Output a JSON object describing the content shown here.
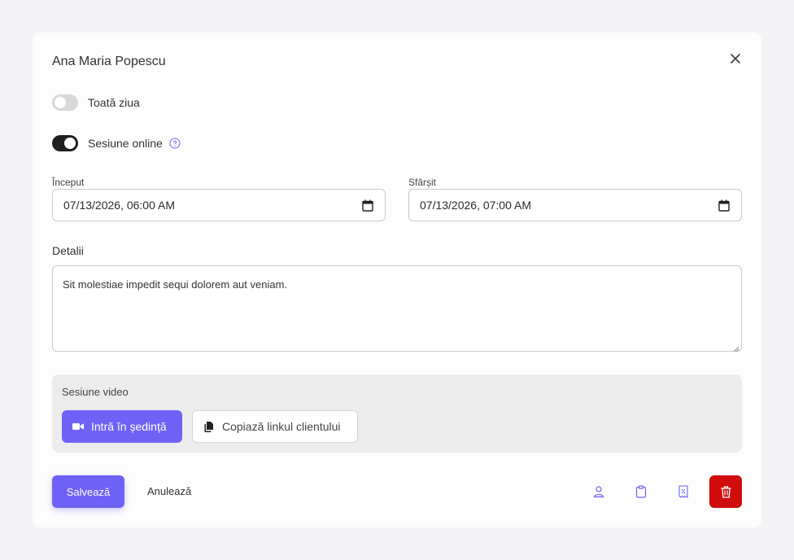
{
  "modal": {
    "title": "Ana Maria Popescu",
    "close_icon": "close-icon"
  },
  "toggles": [
    {
      "label": "Toată ziua",
      "on": false
    },
    {
      "label": "Sesiune online",
      "on": true,
      "help_icon": "question-circle-icon"
    }
  ],
  "dates": {
    "start": {
      "label": "Început",
      "value": "07/13/2026, 06:00 AM",
      "icon": "calendar-icon"
    },
    "end": {
      "label": "Sfârșit",
      "value": "07/13/2026, 07:00 AM",
      "icon": "calendar-icon"
    }
  },
  "details": {
    "label": "Detalii",
    "value": "Sit molestiae impedit sequi dolorem aut veniam."
  },
  "video": {
    "title": "Sesiune video",
    "join_label": "Intră în ședință",
    "join_icon": "video-camera-icon",
    "copy_label": "Copiază linkul clientului",
    "copy_icon": "copy-icon"
  },
  "footer": {
    "save_label": "Salvează",
    "cancel_label": "Anulează",
    "icons": [
      "user-icon",
      "clipboard-icon",
      "invoice-icon",
      "trash-icon"
    ]
  },
  "colors": {
    "accent": "#6e62f6",
    "danger": "#d00d0d",
    "toggle_on": "#1f1f22",
    "toggle_off": "#d8d8d8"
  }
}
